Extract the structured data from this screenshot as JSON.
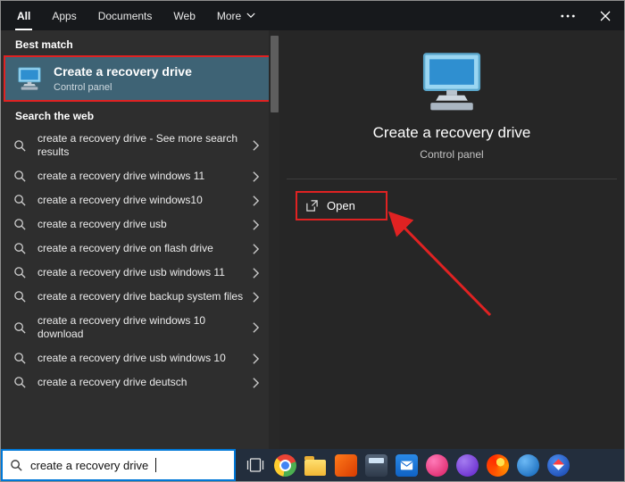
{
  "topbar": {
    "tabs": [
      {
        "label": "All"
      },
      {
        "label": "Apps"
      },
      {
        "label": "Documents"
      },
      {
        "label": "Web"
      },
      {
        "label": "More"
      }
    ]
  },
  "left_panel": {
    "best_match_header": "Best match",
    "best_match": {
      "title": "Create a recovery drive",
      "subtitle": "Control panel"
    },
    "search_web_header": "Search the web",
    "suggestions": [
      "create a recovery drive - See more search results",
      "create a recovery drive windows 11",
      "create a recovery drive windows10",
      "create a recovery drive usb",
      "create a recovery drive on flash drive",
      "create a recovery drive usb windows 11",
      "create a recovery drive backup system files",
      "create a recovery drive windows 10 download",
      "create a recovery drive usb windows 10",
      "create a recovery drive deutsch"
    ]
  },
  "preview_panel": {
    "title": "Create a recovery drive",
    "subtitle": "Control panel",
    "open_button": "Open"
  },
  "taskbar": {
    "search_value": "create a recovery drive",
    "icons": [
      "task-view",
      "chrome",
      "file-explorer",
      "app-orange",
      "app-gray",
      "mail",
      "app-pink",
      "app-purple",
      "firefox",
      "thunderbird",
      "app-compass"
    ]
  },
  "colors": {
    "annotation_red": "#e02222",
    "best_match_highlight": "#3e6375",
    "search_border_blue": "#0078d7"
  }
}
